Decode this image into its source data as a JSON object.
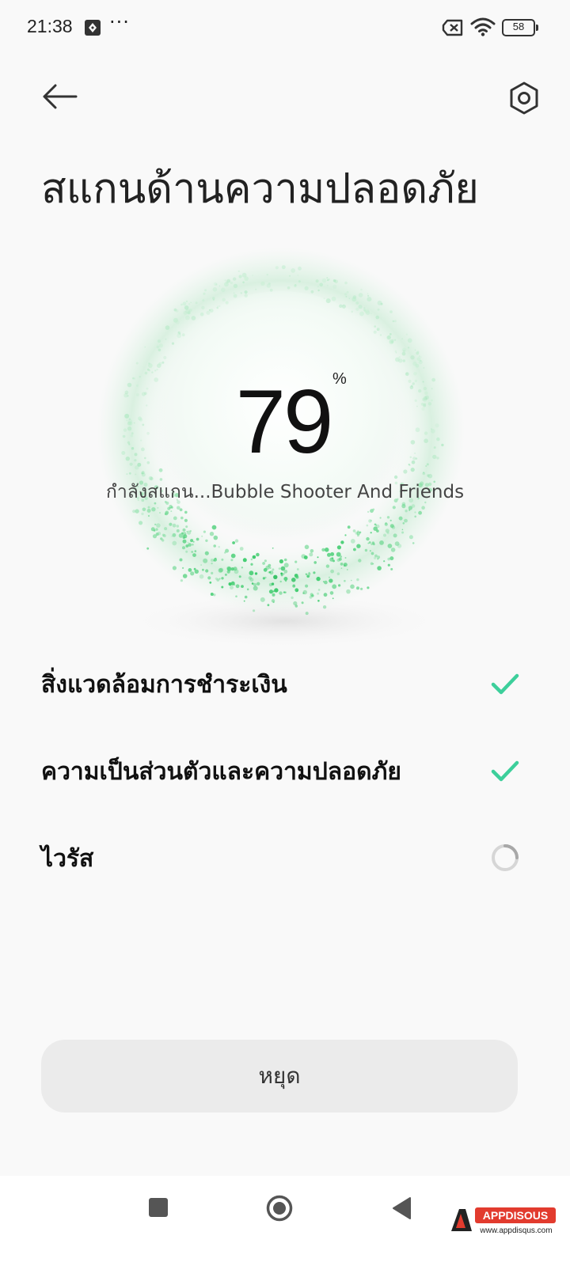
{
  "status_bar": {
    "time": "21:38",
    "more_indicator": "···",
    "battery_level": "58",
    "icons": [
      "notification-app-icon",
      "sim-off-icon",
      "wifi-icon",
      "battery-icon"
    ]
  },
  "header": {
    "back_icon": "arrow-left-icon",
    "settings_icon": "settings-hexagon-icon",
    "title": "สแกนด้านความปลอดภัย"
  },
  "scan": {
    "progress_value": "79",
    "progress_unit": "%",
    "status_text": "กำลังสแกน...Bubble Shooter And Friends",
    "accent_color": "#35c46a"
  },
  "checklist": [
    {
      "label": "สิ่งแวดล้อมการชำระเงิน",
      "state": "done",
      "icon": "check-icon"
    },
    {
      "label": "ความเป็นส่วนตัวและความปลอดภัย",
      "state": "done",
      "icon": "check-icon"
    },
    {
      "label": "ไวรัส",
      "state": "scanning",
      "icon": "loading-spinner-icon"
    }
  ],
  "check_color": "#3dcf9b",
  "stop_button": {
    "label": "หยุด"
  },
  "nav_bar": {
    "icons": [
      "recent-apps-icon",
      "home-icon",
      "back-icon"
    ]
  },
  "watermark": {
    "brand": "APPDISOUS",
    "url": "www.appdisqus.com"
  }
}
